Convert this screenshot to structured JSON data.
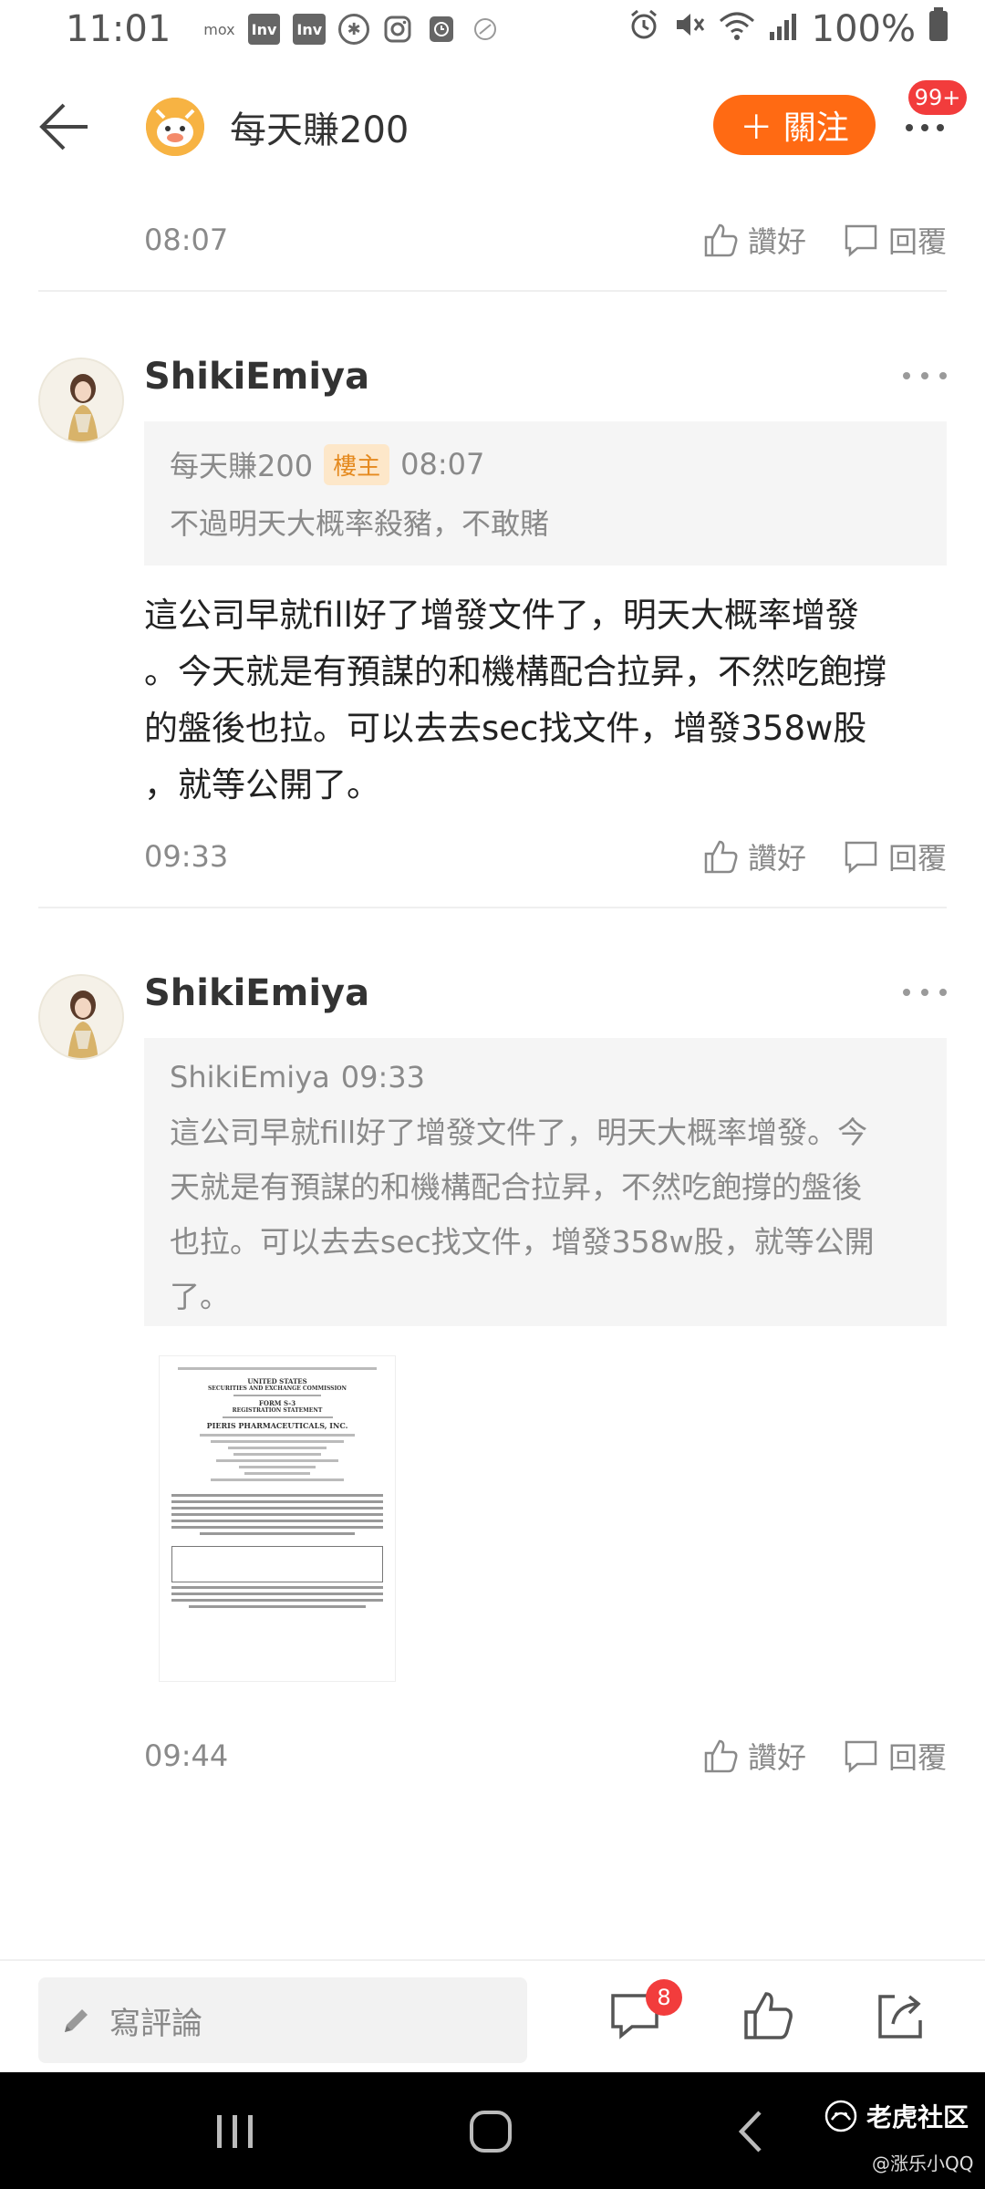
{
  "status_bar": {
    "time": "11:01",
    "icons_left": [
      "mox",
      "Inv",
      "Inv",
      "asterisk-circle-icon",
      "instagram-icon",
      "clock-app-icon",
      "app-icon"
    ],
    "battery": "100%"
  },
  "header": {
    "title": "每天賺200",
    "follow_label": "＋ 關注",
    "notification_badge": "99+"
  },
  "comments": [
    {
      "time": "08:07",
      "like_label": "讚好",
      "reply_label": "回覆"
    },
    {
      "username": "ShikiEmiya",
      "quote": {
        "author": "每天賺200",
        "badge": "樓主",
        "time": "08:07",
        "text": "不過明天大概率殺豬，不敢賭"
      },
      "body_lines": [
        "這公司早就fill好了增發文件了，明天大概率增發",
        "。今天就是有預謀的和機構配合拉昇，不然吃飽撐",
        "的盤後也拉。可以去去sec找文件，增發358w股",
        "，就等公開了。"
      ],
      "time": "09:33",
      "like_label": "讚好",
      "reply_label": "回覆"
    },
    {
      "username": "ShikiEmiya",
      "quote": {
        "author": "ShikiEmiya",
        "time": "09:33",
        "text_lines": [
          "這公司早就fill好了增發文件了，明天大概率增發。今",
          "天就是有預謀的和機構配合拉昇，不然吃飽撐的盤後",
          "也拉。可以去去sec找文件，增發358w股，就等公開",
          "了。"
        ]
      },
      "attachment": {
        "line1": "UNITED STATES",
        "line2": "SECURITIES AND EXCHANGE COMMISSION",
        "line3": "FORM S-3",
        "line4": "REGISTRATION STATEMENT",
        "line5": "PIERIS PHARMACEUTICALS, INC."
      },
      "time": "09:44",
      "like_label": "讚好",
      "reply_label": "回覆"
    }
  ],
  "bottom_bar": {
    "comment_placeholder": "寫評論",
    "comment_count": "8"
  },
  "watermark": {
    "brand": "老虎社区",
    "user": "@涨乐小QQ"
  }
}
